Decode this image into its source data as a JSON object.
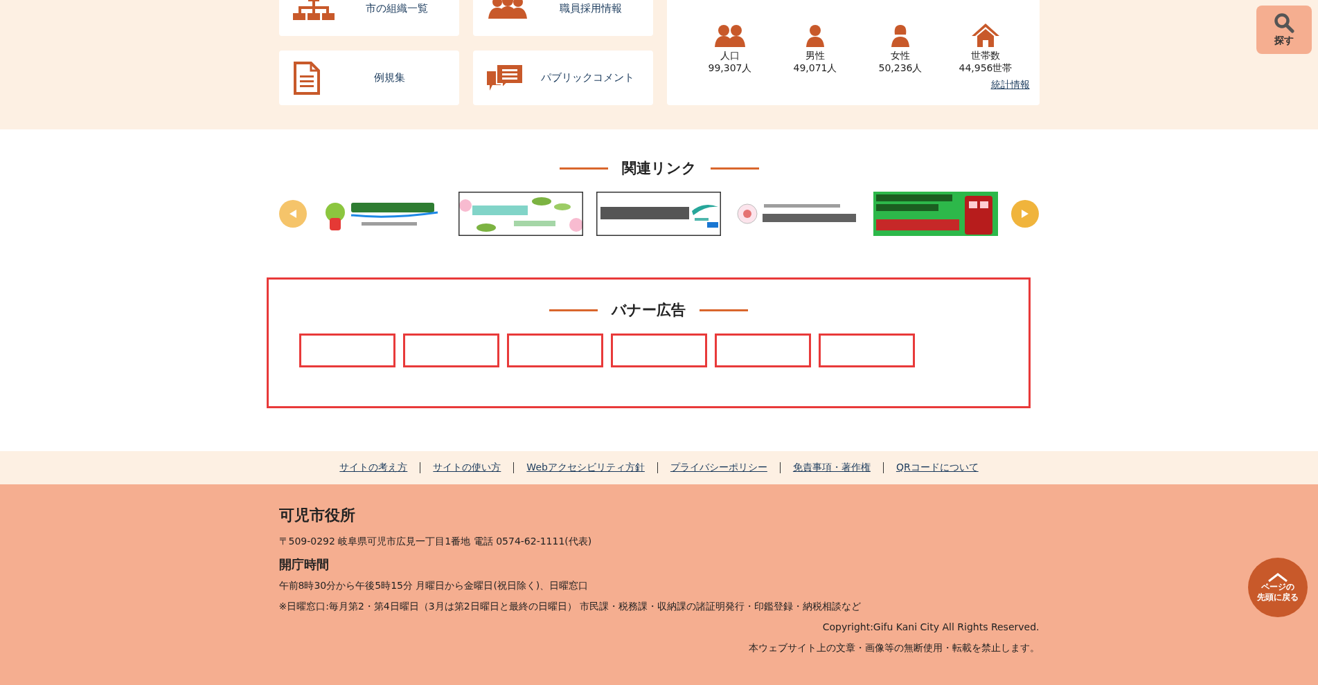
{
  "quick_links": [
    {
      "label": "市の組織一覧"
    },
    {
      "label": "職員採用情報"
    },
    {
      "label": "例規集"
    },
    {
      "label": "パブリックコメント"
    }
  ],
  "stats": {
    "items": [
      {
        "label": "人口",
        "value": "99,307人"
      },
      {
        "label": "男性",
        "value": "49,071人"
      },
      {
        "label": "女性",
        "value": "50,236人"
      },
      {
        "label": "世帯数",
        "value": "44,956世帯"
      }
    ],
    "link": "統計情報"
  },
  "search_button": {
    "label": "探す"
  },
  "related_links": {
    "title": "関連リンク"
  },
  "banner_ads": {
    "title": "バナー広告",
    "slots": [
      {
        "kind": "empty"
      },
      {
        "kind": "empty"
      },
      {
        "kind": "empty"
      },
      {
        "kind": "empty"
      },
      {
        "kind": "empty"
      },
      {
        "kind": "empty"
      }
    ]
  },
  "footer_links": [
    "サイトの考え方",
    "サイトの使い方",
    "Webアクセシビリティ方針",
    "プライバシーポリシー",
    "免責事項・著作権",
    "QRコードについて"
  ],
  "footer": {
    "name": "可児市役所",
    "address": "〒509-0292 岐阜県可児市広見一丁目1番地 電話 0574-62-1111(代表)",
    "hours_title": "開庁時間",
    "hours": "午前8時30分から午後5時15分 月曜日から金曜日(祝日除く)、日曜窓口",
    "note": "※日曜窓口:毎月第2・第4日曜日（3月は第2日曜日と最終の日曜日） 市民課・税務課・収納課の諸証明発行・印鑑登録・納税相談など",
    "copyright": "Copyright:Gifu Kani City All Rights Reserved.",
    "notice": "本ウェブサイト上の文章・画像等の無断使用・転載を禁止します。"
  },
  "back_to_top": {
    "lines": [
      "ページの",
      "先頭に戻る"
    ]
  }
}
